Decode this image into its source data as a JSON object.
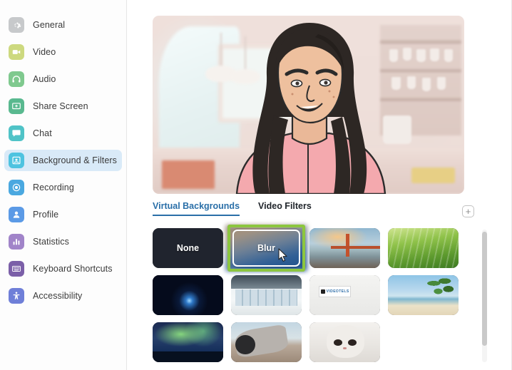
{
  "sidebar": {
    "items": [
      {
        "label": "General",
        "icon": "gear-icon",
        "color": "#c7c9cb",
        "selected": false
      },
      {
        "label": "Video",
        "icon": "camera-icon",
        "color": "#cdd97f",
        "selected": false
      },
      {
        "label": "Audio",
        "icon": "headphones-icon",
        "color": "#7fc98e",
        "selected": false
      },
      {
        "label": "Share Screen",
        "icon": "share-screen-icon",
        "color": "#59b98f",
        "selected": false
      },
      {
        "label": "Chat",
        "icon": "chat-icon",
        "color": "#4fc3c7",
        "selected": false
      },
      {
        "label": "Background & Filters",
        "icon": "background-filters-icon",
        "color": "#4ec3e0",
        "selected": true
      },
      {
        "label": "Recording",
        "icon": "record-icon",
        "color": "#4aa8e0",
        "selected": false
      },
      {
        "label": "Profile",
        "icon": "profile-icon",
        "color": "#5b9ae6",
        "selected": false
      },
      {
        "label": "Statistics",
        "icon": "statistics-icon",
        "color": "#a184c9",
        "selected": false
      },
      {
        "label": "Keyboard Shortcuts",
        "icon": "keyboard-icon",
        "color": "#7b5fa8",
        "selected": false
      },
      {
        "label": "Accessibility",
        "icon": "accessibility-icon",
        "color": "#6f7fd8",
        "selected": false
      }
    ],
    "selected_highlight_color": "#d9eaf8"
  },
  "main": {
    "preview_alt": "Video preview of a person in a kitchen",
    "tabs": [
      {
        "label": "Virtual Backgrounds",
        "active": true
      },
      {
        "label": "Video Filters",
        "active": false
      }
    ],
    "add_button_label": "+",
    "accent_color": "#2a6fa8",
    "highlight_color": "#8cc63f",
    "backgrounds": [
      [
        {
          "name": "None",
          "label": "None",
          "art": "art-none",
          "selected": false,
          "highlighted": false
        },
        {
          "name": "Blur",
          "label": "Blur",
          "art": "art-blur",
          "selected": true,
          "highlighted": true
        },
        {
          "name": "Golden Gate Bridge",
          "label": "",
          "art": "art-bridge",
          "selected": false,
          "highlighted": false
        },
        {
          "name": "Grass",
          "label": "",
          "art": "art-grass",
          "selected": false,
          "highlighted": false
        }
      ],
      [
        {
          "name": "Earth from space",
          "label": "",
          "art": "art-space",
          "selected": false,
          "highlighted": false
        },
        {
          "name": "Modern office",
          "label": "",
          "art": "art-office",
          "selected": false,
          "highlighted": false
        },
        {
          "name": "White wall",
          "label": "",
          "art": "art-white",
          "selected": false,
          "highlighted": false
        },
        {
          "name": "Beach with palm tree",
          "label": "",
          "art": "art-beach",
          "selected": false,
          "highlighted": false
        }
      ],
      [
        {
          "name": "Aurora borealis",
          "label": "",
          "art": "art-aurora",
          "selected": false,
          "highlighted": false
        },
        {
          "name": "Car",
          "label": "",
          "art": "art-car",
          "selected": false,
          "highlighted": false
        },
        {
          "name": "Kitten",
          "label": "",
          "art": "art-cat",
          "selected": false,
          "highlighted": false
        }
      ]
    ],
    "white_tile_logo": "VIDEOTELS"
  }
}
